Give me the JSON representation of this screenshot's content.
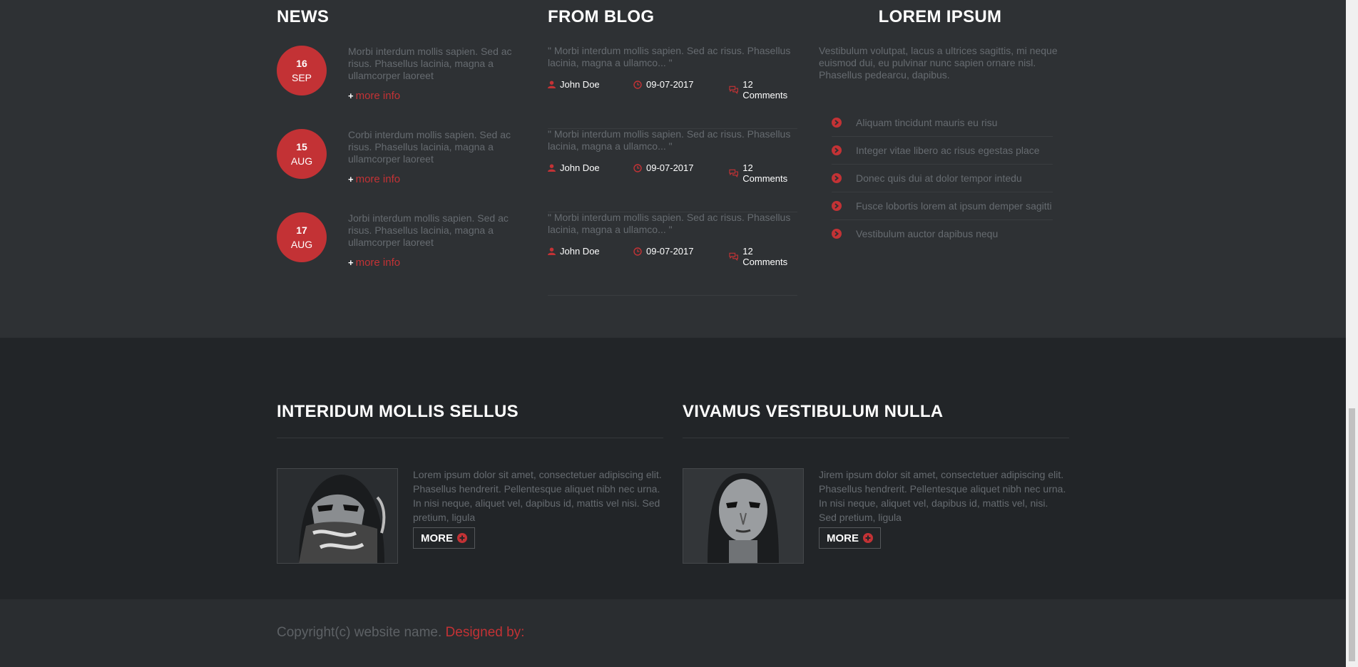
{
  "news": {
    "title": "NEWS",
    "items": [
      {
        "day": "16",
        "month": "SEP",
        "text": "Morbi interdum mollis sapien. Sed ac risus. Phasellus lacinia, magna a ullamcorper laoreet",
        "more": "more info"
      },
      {
        "day": "15",
        "month": "AUG",
        "text": "Corbi interdum mollis sapien. Sed ac risus. Phasellus lacinia, magna a ullamcorper laoreet",
        "more": "more info"
      },
      {
        "day": "17",
        "month": "AUG",
        "text": "Jorbi interdum mollis sapien. Sed ac risus. Phasellus lacinia, magna a ullamcorper laoreet",
        "more": "more info"
      }
    ]
  },
  "blog": {
    "title": "FROM BLOG",
    "items": [
      {
        "quote": "\" Morbi interdum mollis sapien. Sed ac risus. Phasellus lacinia, magna a ullamco... \"",
        "author": "John Doe",
        "date": "09-07-2017",
        "comments": "12 Comments"
      },
      {
        "quote": "\" Morbi interdum mollis sapien. Sed ac risus. Phasellus lacinia, magna a ullamco... \"",
        "author": "John Doe",
        "date": "09-07-2017",
        "comments": "12 Comments"
      },
      {
        "quote": "\" Morbi interdum mollis sapien. Sed ac risus. Phasellus lacinia, magna a ullamco... \"",
        "author": "John Doe",
        "date": "09-07-2017",
        "comments": "12 Comments"
      }
    ]
  },
  "lorem": {
    "title": "LOREM IPSUM",
    "paragraph": "Vestibulum volutpat, lacus a ultrices sagittis, mi neque euismod dui, eu pulvinar nunc sapien ornare nisl. Phasellus pedearcu, dapibus.",
    "items": [
      "Aliquam tincidunt mauris eu risu",
      "Integer vitae libero ac risus egestas place",
      "Donec quis dui at dolor tempor intedu",
      "Fusce lobortis lorem at ipsum demper sagitti",
      "Vestibulum auctor dapibus nequ"
    ]
  },
  "features": [
    {
      "title": "INTERIDUM MOLLIS SELLUS",
      "text": "Lorem ipsum dolor sit amet, consectetuer adipiscing elit. Phasellus hendrerit. Pellentesque aliquet nibh nec urna. In nisi neque, aliquet vel, dapibus id, mattis vel nisi. Sed pretium, ligula",
      "button": "MORE"
    },
    {
      "title": "VIVAMUS VESTIBULUM NULLA",
      "text": "Jirem ipsum dolor sit amet, consectetuer adipiscing elit. Phasellus hendrerit. Pellentesque aliquet nibh nec urna. In nisi neque, aliquet vel, dapibus id, mattis vel, nisi. Sed pretium, ligula",
      "button": "MORE"
    }
  ],
  "footer": {
    "copyright": "Copyright(c) website name.",
    "designed": "Designed by:"
  },
  "colors": {
    "accent": "#c33235",
    "bg_top": "#2e3134",
    "bg_mid": "#222528"
  }
}
